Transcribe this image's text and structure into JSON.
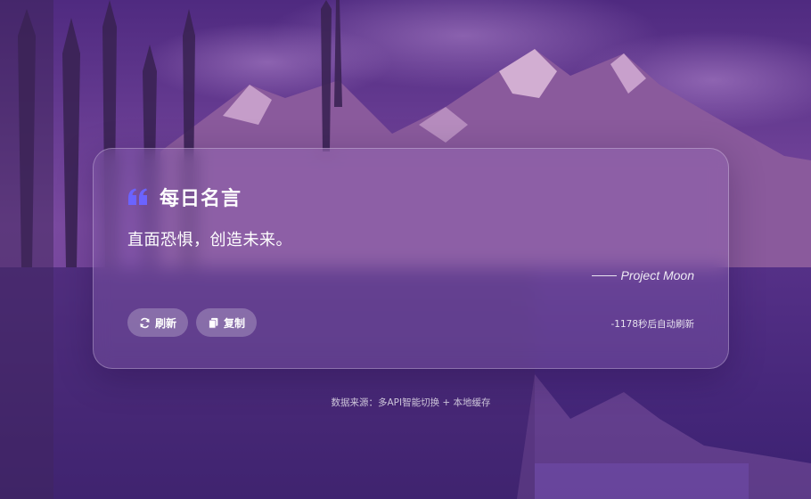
{
  "card": {
    "title": "每日名言",
    "quote": "直面恐惧，创造未来。",
    "author": "Project Moon",
    "buttons": {
      "refresh_label": "刷新",
      "copy_label": "复制"
    },
    "timer_text": "-1178秒后自动刷新"
  },
  "footer": {
    "source_note": "数据来源：多API智能切换 + 本地缓存"
  },
  "icons": {
    "title_icon": "quote-icon",
    "refresh_icon": "refresh-icon",
    "copy_icon": "copy-icon"
  },
  "colors": {
    "accent": "#6b63ff",
    "background_purple": "#5a2f86",
    "text": "#ffffff"
  }
}
